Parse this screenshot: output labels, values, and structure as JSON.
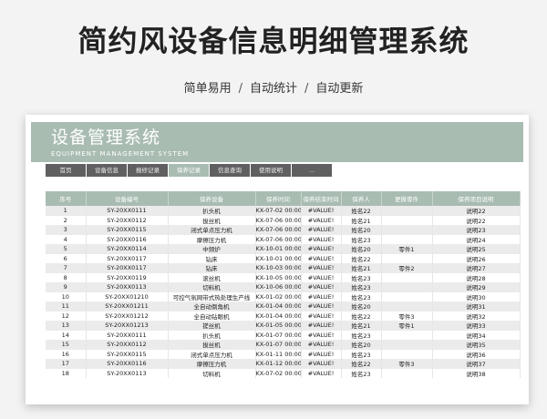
{
  "hero": {
    "title": "简约风设备信息明细管理系统",
    "features": [
      "简单易用",
      "自动统计",
      "自动更新"
    ],
    "separator": "/"
  },
  "app": {
    "title": "设备管理系统",
    "subtitle": "EQUIPMENT MANAGEMENT SYSTEM"
  },
  "nav": {
    "tabs": [
      "首页",
      "设备信息",
      "报修记录",
      "保养记录",
      "信息查询",
      "使用说明",
      "..."
    ],
    "active_index": 3
  },
  "table": {
    "columns": [
      "序号",
      "设备编号",
      "保养设备",
      "保养时间",
      "保养结束时间",
      "保养人",
      "更换零件",
      "保养项目说明"
    ],
    "rows": [
      [
        "1",
        "SY-20XX0111",
        "扒头机",
        "KX-07-02 00:00",
        "#VALUE!",
        "姓名22",
        "",
        "说明22"
      ],
      [
        "2",
        "SY-20XX0112",
        "拔丝机",
        "KX-07-06 00:00",
        "#VALUE!",
        "姓名21",
        "",
        "说明22"
      ],
      [
        "3",
        "SY-20XX0115",
        "闭式单点压力机",
        "KX-07-06 00:00",
        "#VALUE!",
        "姓名20",
        "",
        "说明23"
      ],
      [
        "4",
        "SY-20XX0116",
        "摩擦压力机",
        "KX-07-06 00:00",
        "#VALUE!",
        "姓名23",
        "",
        "说明24"
      ],
      [
        "5",
        "SY-20XX0114",
        "中频炉",
        "KX-10-01 00:00",
        "#VALUE!",
        "姓名20",
        "零件1",
        "说明25"
      ],
      [
        "6",
        "SY-20XX0117",
        "钻床",
        "KX-10-01 00:00",
        "#VALUE!",
        "姓名22",
        "",
        "说明26"
      ],
      [
        "7",
        "SY-20XX0117",
        "钻床",
        "KX-10-03 00:00",
        "#VALUE!",
        "姓名21",
        "零件2",
        "说明27"
      ],
      [
        "8",
        "SY-20XX0119",
        "滚丝机",
        "KX-10-05 00:00",
        "#VALUE!",
        "姓名23",
        "",
        "说明28"
      ],
      [
        "9",
        "SY-20XX0113",
        "切料机",
        "KX-10-06 00:00",
        "#VALUE!",
        "姓名23",
        "",
        "说明29"
      ],
      [
        "10",
        "SY-20XX01210",
        "可控气氛网带式热处理生产线",
        "KX-01-02 00:00",
        "#VALUE!",
        "姓名23",
        "",
        "说明30"
      ],
      [
        "11",
        "SY-20XX01211",
        "全自动倒角机",
        "KX-01-04 00:00",
        "#VALUE!",
        "姓名20",
        "",
        "说明31"
      ],
      [
        "12",
        "SY-20XX01212",
        "全自动钻眼机",
        "KX-01-04 00:00",
        "#VALUE!",
        "姓名22",
        "零件3",
        "说明32"
      ],
      [
        "13",
        "SY-20XX01213",
        "搓丝机",
        "KX-01-05 00:00",
        "#VALUE!",
        "姓名21",
        "零件1",
        "说明33"
      ],
      [
        "14",
        "SY-20XX0111",
        "扒头机",
        "KX-01-07 00:00",
        "#VALUE!",
        "姓名23",
        "",
        "说明34"
      ],
      [
        "15",
        "SY-20XX0112",
        "拔丝机",
        "KX-01-07 00:00",
        "#VALUE!",
        "姓名20",
        "",
        "说明35"
      ],
      [
        "16",
        "SY-20XX0115",
        "闭式单点压力机",
        "KX-01-11 00:00",
        "#VALUE!",
        "姓名23",
        "",
        "说明36"
      ],
      [
        "17",
        "SY-20XX0116",
        "摩擦压力机",
        "KX-01-12 00:00",
        "#VALUE!",
        "姓名22",
        "零件3",
        "说明37"
      ],
      [
        "18",
        "SY-20XX0113",
        "切料机",
        "KX-07-02 00:00",
        "#VALUE!",
        "姓名23",
        "",
        "说明38"
      ]
    ]
  }
}
